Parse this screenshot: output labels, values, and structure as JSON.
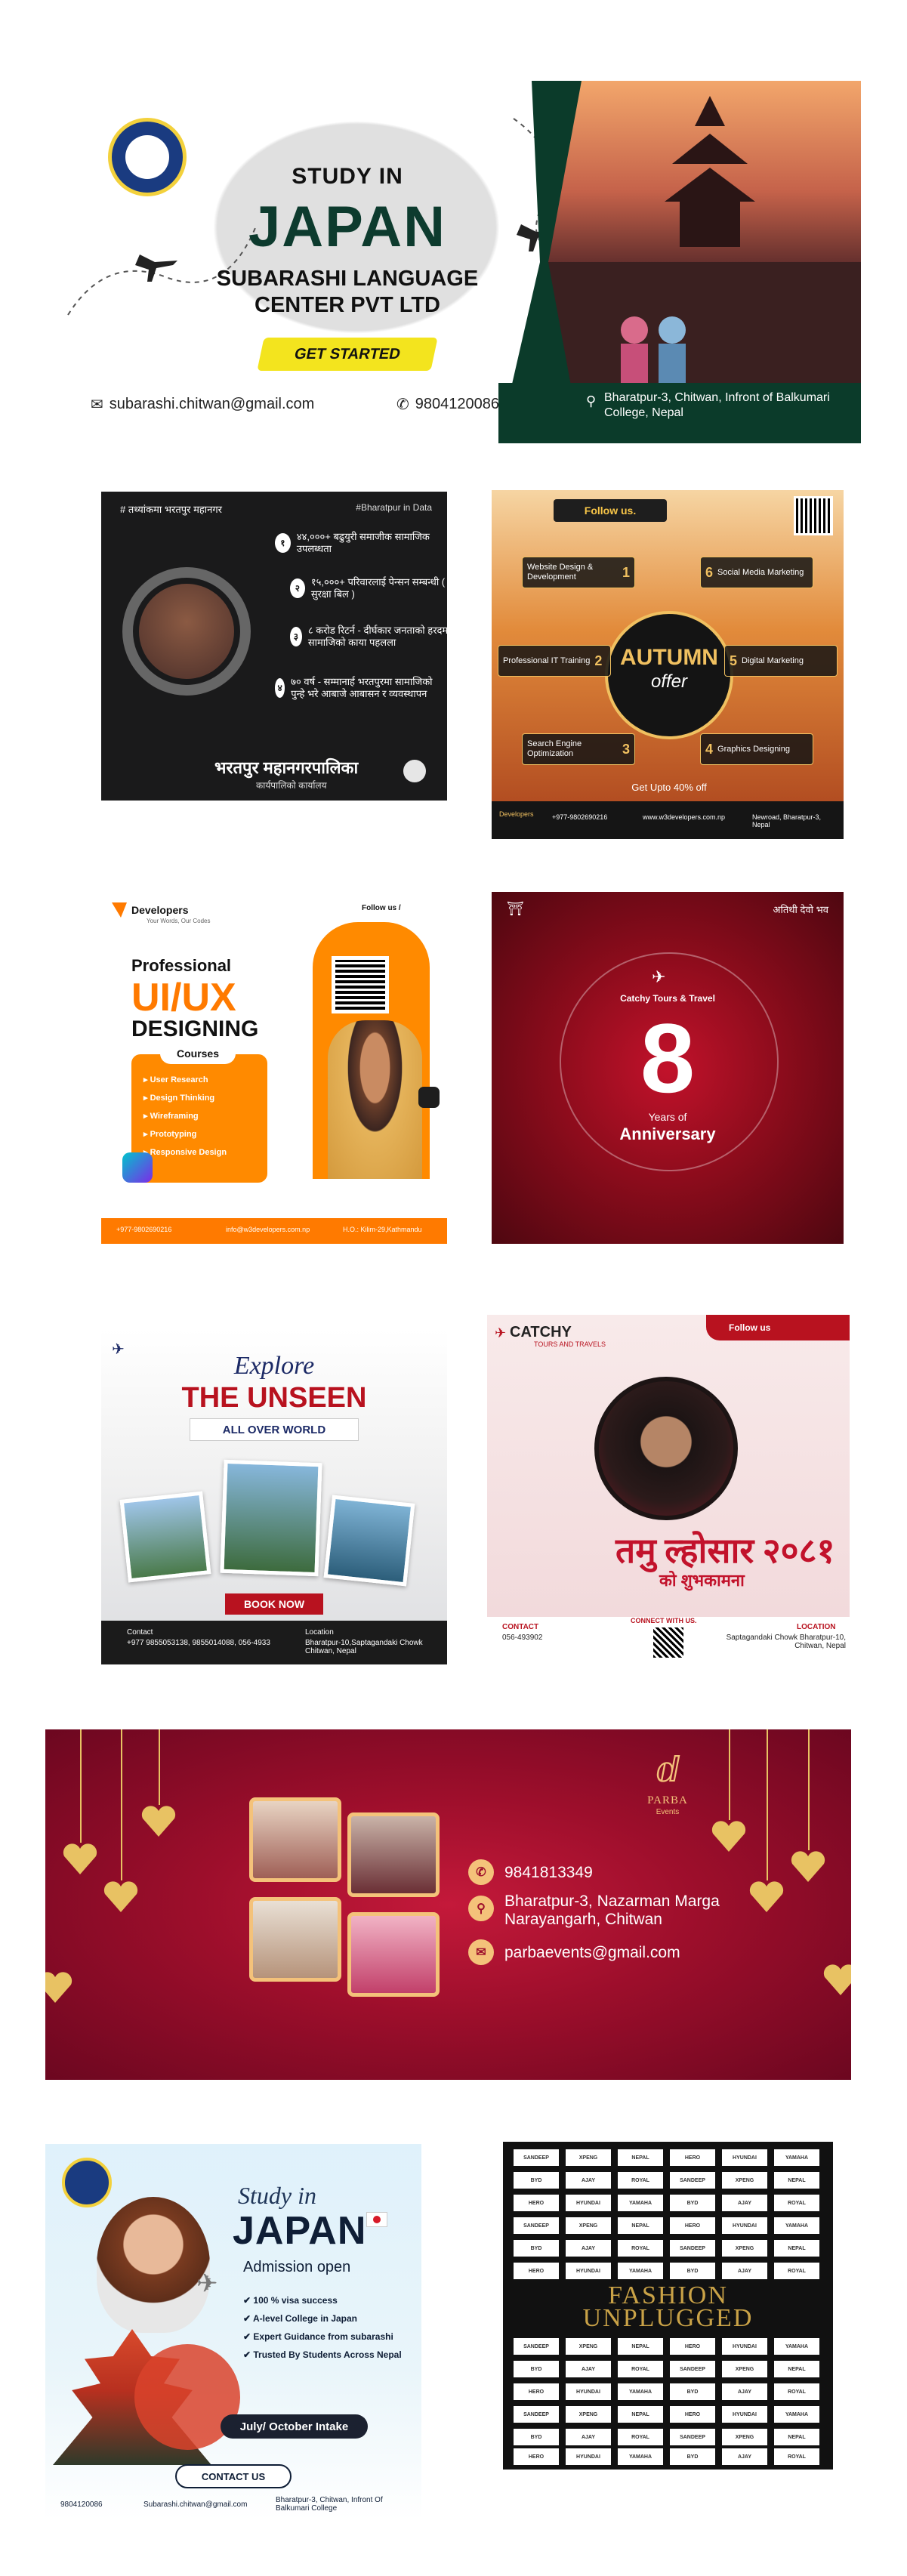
{
  "colors": {
    "japan_green": "#0b3b2a",
    "accent_yellow": "#f3e41e",
    "brand_orange": "#ff7a00",
    "brand_red": "#b8121f",
    "maroon": "#9c0e2b",
    "gold": "#f4c27a"
  },
  "p1": {
    "title_small": "STUDY IN",
    "title_large": "JAPAN",
    "subtitle_1": "SUBARASHI LANGUAGE",
    "subtitle_2": "CENTER PVT LTD",
    "cta": "GET STARTED",
    "email": "subarashi.chitwan@gmail.com",
    "phone": "9804120086",
    "address": "Bharatpur-3, Chitwan, Infront of Balkumari College, Nepal",
    "icons": [
      "email-icon",
      "phone-icon",
      "location-icon",
      "airplane-icon"
    ]
  },
  "p2": {
    "header_left": "# तथ्यांकमा भरतपुर महानगर",
    "header_right": "#Bharatpur in Data",
    "rows": [
      {
        "num": "१",
        "text": "४४,०००+ बढुयुरी समाजीक सामाजिक उपलब्धता"
      },
      {
        "num": "२",
        "text": "१५,०००+ परिवारलाई पेन्सन सम्बन्धी ( सुरक्षा बिल )"
      },
      {
        "num": "३",
        "text": "८ करोड रिटर्न - दीर्घकार जनताको हरदम सामाजिको काया पहलला"
      },
      {
        "num": "४",
        "text": "७० वर्ष - सम्मानार्ह भरतपुरमा सामाजिको पुन्हे भरे आबाजे आबासन र व्यवस्थापन"
      }
    ],
    "footer_title": "भरतपुर महानगरपालिका",
    "footer_sub": "कार्यपालिको कार्यालय"
  },
  "p3": {
    "follow": "Follow us.",
    "center_title": "AUTUMN",
    "center_sub": "offer",
    "cards": [
      {
        "n": "1",
        "text": "Website Design & Development"
      },
      {
        "n": "2",
        "text": "Professional IT Training"
      },
      {
        "n": "3",
        "text": "Search Engine Optimization"
      },
      {
        "n": "4",
        "text": "Graphics Designing"
      },
      {
        "n": "5",
        "text": "Digital Marketing"
      },
      {
        "n": "6",
        "text": "Social Media Marketing"
      }
    ],
    "upto": "Get Upto 40% off",
    "footer_phone": "+977-9802690216",
    "footer_web": "www.w3developers.com.np",
    "footer_loc": "Newroad, Bharatpur-3, Nepal",
    "brand": "Developers"
  },
  "p4": {
    "brand": "Developers",
    "tagline": "Your Words, Our Codes",
    "follow": "Follow us /",
    "professional": "Professional",
    "uiux": "UI/UX",
    "designing": "DESIGNING",
    "courses_label": "Courses",
    "courses": [
      "User Research",
      "Design Thinking",
      "Wireframing",
      "Prototyping",
      "Responsive Design"
    ],
    "phone": "+977-9802690216",
    "email": "info@w3developers.com.np",
    "address": "H.O.: Kilim-29,Kathmandu"
  },
  "p5": {
    "top_right": "अतिथी देवो भव",
    "brand": "Catchy Tours & Travel",
    "number": "8",
    "years": "Years of",
    "anniversary": "Anniversary"
  },
  "p6": {
    "explore": "Explore",
    "unseen": "THE UNSEEN",
    "allover": "ALL OVER WORLD",
    "book": "BOOK NOW",
    "contact_label": "Contact",
    "contact_value": "+977 9855053138, 9855014088, 056-4933",
    "location_label": "Location",
    "location_value": "Bharatpur-10,Saptagandaki Chowk Chitwan, Nepal"
  },
  "p7": {
    "brand": "CATCHY",
    "brand_sub": "TOURS AND TRAVELS",
    "follow": "Follow us",
    "headline": "तमु ल्होसार २०८१",
    "subline": "को शुभकामना",
    "connect": "CONNECT WITH US.",
    "contact_label": "CONTACT",
    "contact_value": "056-493902",
    "location_label": "LOCATION",
    "location_value": "Saptagandaki Chowk Bharatpur-10, Chitwan, Nepal"
  },
  "p8": {
    "phone": "9841813349",
    "address_1": "Bharatpur-3, Nazarman Marga",
    "address_2": "Narayangarh, Chitwan",
    "email": "parbaevents@gmail.com",
    "logo_text": "PARBA",
    "logo_sub": "Events"
  },
  "p9": {
    "study": "Study in",
    "japan": "JAPAN",
    "admission": "Admission open",
    "items": [
      "100 % visa success",
      "A-level College in Japan",
      "Expert Guidance from subarashi",
      "Trusted By Students Across Nepal"
    ],
    "intake": "July/ October Intake",
    "contact": "CONTACT US",
    "phone": "9804120086",
    "email": "Subarashi.chitwan@gmail.com",
    "address": "Bharatpur-3, Chitwan, Infront Of Balkumari College"
  },
  "p10": {
    "fashion": "FASHION",
    "unplugged": "UNPLUGGED",
    "sponsors": [
      "SANDEEP",
      "XPENG",
      "NEPAL",
      "HERO",
      "HYUNDAI",
      "YAMAHA",
      "BYD",
      "AJAY",
      "ROYAL"
    ]
  }
}
